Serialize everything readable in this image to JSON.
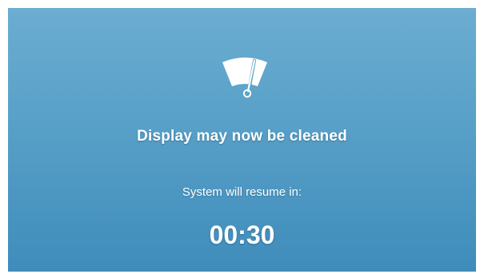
{
  "screen": {
    "icon": "windshield-wiper-icon",
    "title": "Display may now be cleaned",
    "resume_label": "System will resume in:",
    "countdown": "00:30",
    "colors": {
      "background_top": "#6cadd1",
      "background_bottom": "#3f8cbb",
      "text": "#ffffff"
    }
  }
}
